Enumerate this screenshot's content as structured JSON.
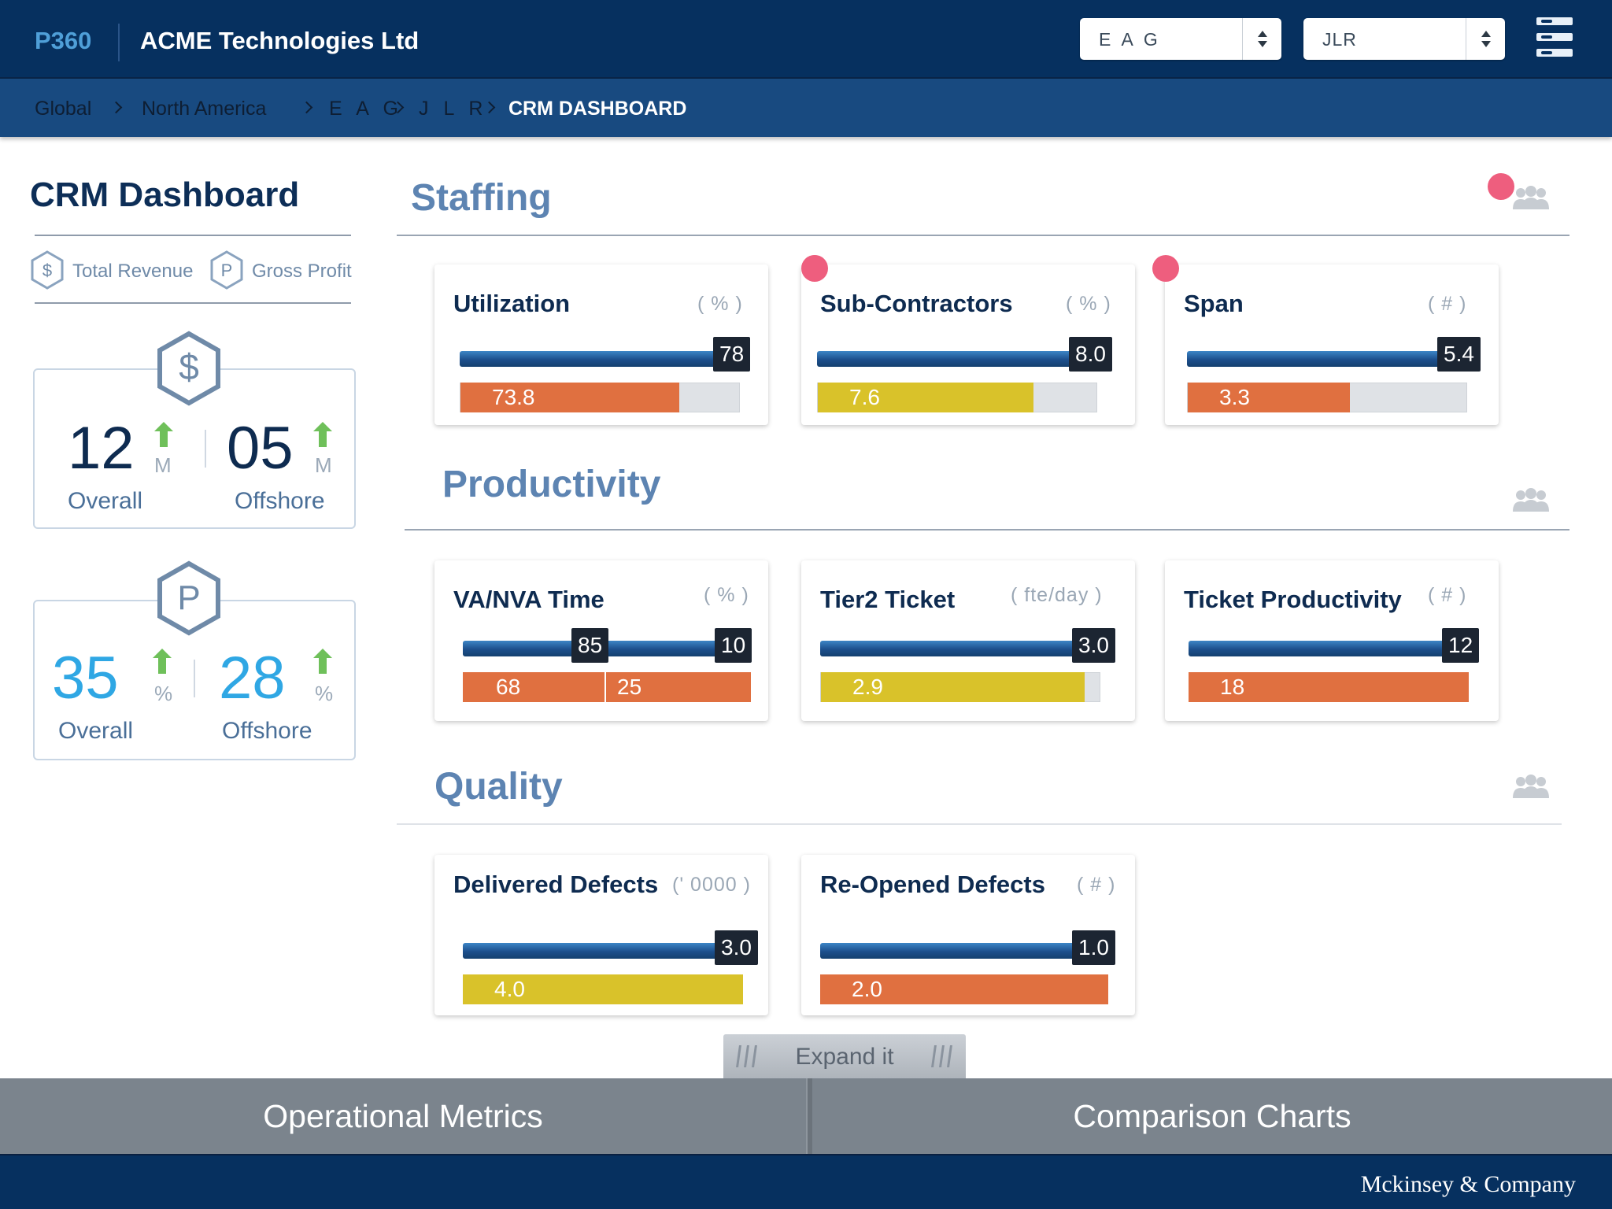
{
  "header": {
    "logo": "P360",
    "company": "ACME Technologies Ltd",
    "select_1": "E A G",
    "select_2": "JLR"
  },
  "breadcrumb": [
    "Global",
    "North America",
    "E A G",
    "J L R",
    "CRM DASHBOARD"
  ],
  "left_panel": {
    "title": "CRM Dashboard",
    "legend": {
      "revenue_symbol": "$",
      "revenue_label": "Total Revenue",
      "profit_symbol": "P",
      "profit_label": "Gross Profit"
    },
    "revenue": {
      "overall_value": "12",
      "overall_unit": "M",
      "overall_label": "Overall",
      "offshore_value": "05",
      "offshore_unit": "M",
      "offshore_label": "Offshore",
      "trend": "up"
    },
    "profit": {
      "overall_value": "35",
      "overall_unit": "%",
      "overall_label": "Overall",
      "offshore_value": "28",
      "offshore_unit": "%",
      "offshore_label": "Offshore",
      "trend": "up"
    }
  },
  "sections": {
    "staffing": {
      "title": "Staffing",
      "cards": [
        {
          "title": "Utilization",
          "unit": "( % )",
          "target": "78",
          "actual": "73.8",
          "actual_fraction": 0.78,
          "color": "#e07040",
          "alert": false
        },
        {
          "title": "Sub-Contractors",
          "unit": "( % )",
          "target": "8.0",
          "actual": "7.6",
          "actual_fraction": 0.77,
          "color": "#d9c22a",
          "alert": true
        },
        {
          "title": "Span",
          "unit": "( # )",
          "target": "5.4",
          "actual": "3.3",
          "actual_fraction": 0.58,
          "color": "#e07040",
          "alert": true
        }
      ]
    },
    "productivity": {
      "title": "Productivity",
      "cards": [
        {
          "title": "VA/NVA Time",
          "unit": "( % )",
          "target_a": "85",
          "target_b": "10",
          "actual_a": "68",
          "actual_b": "25",
          "color": "#e07040"
        },
        {
          "title": "Tier2 Ticket",
          "unit": "( fte/day  )",
          "target": "3.0",
          "actual": "2.9",
          "actual_fraction": 0.94,
          "color": "#d9c22a"
        },
        {
          "title": "Ticket Productivity",
          "unit": "( # )",
          "target": "12",
          "actual": "18",
          "actual_fraction": 1.0,
          "color": "#e07040"
        }
      ]
    },
    "quality": {
      "title": "Quality",
      "cards": [
        {
          "title": "Delivered Defects",
          "unit": "(' 0000 )",
          "target": "3.0",
          "actual": "4.0",
          "actual_fraction": 1.0,
          "color": "#d9c22a"
        },
        {
          "title": "Re-Opened Defects",
          "unit": "( # )",
          "target": "1.0",
          "actual": "2.0",
          "actual_fraction": 1.0,
          "color": "#e07040"
        }
      ]
    }
  },
  "expand_label": "Expand it",
  "tabs": [
    "Operational Metrics",
    "Comparison Charts"
  ],
  "footer": "Mckinsey & Company"
}
